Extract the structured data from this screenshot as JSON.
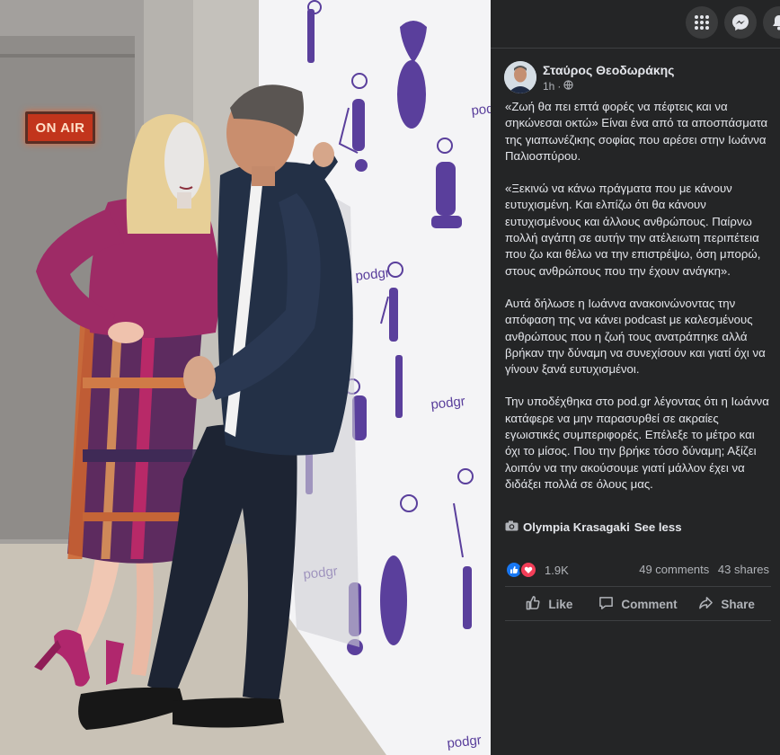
{
  "photo": {
    "sign_text": "ON AIR",
    "wall_brand": "podgr"
  },
  "topbar": {
    "icons": [
      "grid-menu-icon",
      "messenger-icon",
      "notifications-icon"
    ]
  },
  "post": {
    "author": "Σταύρος Θεοδωράκης",
    "time": "1h",
    "separator": "·",
    "paragraphs": [
      "«Ζωή θα πει επτά φορές να πέφτεις και να σηκώνεσαι οκτώ» Είναι ένα από τα αποσπάσματα της γιαπωνέζικης σοφίας που αρέσει στην Ιωάννα Παλιοσπύρου.",
      "«Ξεκινώ να κάνω πράγματα που με κάνουν ευτυχισμένη. Και ελπίζω ότι θα κάνουν ευτυχισμένους και άλλους ανθρώπους. Παίρνω πολλή αγάπη σε αυτήν την ατέλειωτη περιπέτεια που ζω και θέλω να την επιστρέψω, όση μπορώ, στους ανθρώπους που την έχουν ανάγκη».",
      "Αυτά δήλωσε η Ιωάννα ανακοινώνοντας την απόφαση της να κάνει podcast με καλεσμένους ανθρώπους που η ζωή τους ανατράπηκε αλλά βρήκαν την δύναμη να συνεχίσουν και γιατί όχι να γίνουν ξανά ευτυχισμένοι.",
      "Την υποδέχθηκα στο pod.gr λέγοντας ότι η Ιωάννα κατάφερε να μην παρασυρθεί σε ακραίες εγωιστικές συμπεριφορές. Επέλεξε το μέτρο και όχι το μίσος. Που την βρήκε τόσο δύναμη; Αξίζει λοιπόν να την ακούσουμε γιατί μάλλον έχει να διδάξει πολλά σε όλους μας."
    ],
    "credit": "Olympia Krasagaki",
    "see_less": "See less",
    "reaction_count": "1.9K",
    "comments": "49 comments",
    "shares": "43 shares",
    "actions": {
      "like": "Like",
      "comment": "Comment",
      "share": "Share"
    }
  },
  "colors": {
    "panel_bg": "#242526",
    "text": "#e4e6eb",
    "muted": "#b0b3b8",
    "like_blue": "#1877f2",
    "love_red": "#f33e58"
  }
}
